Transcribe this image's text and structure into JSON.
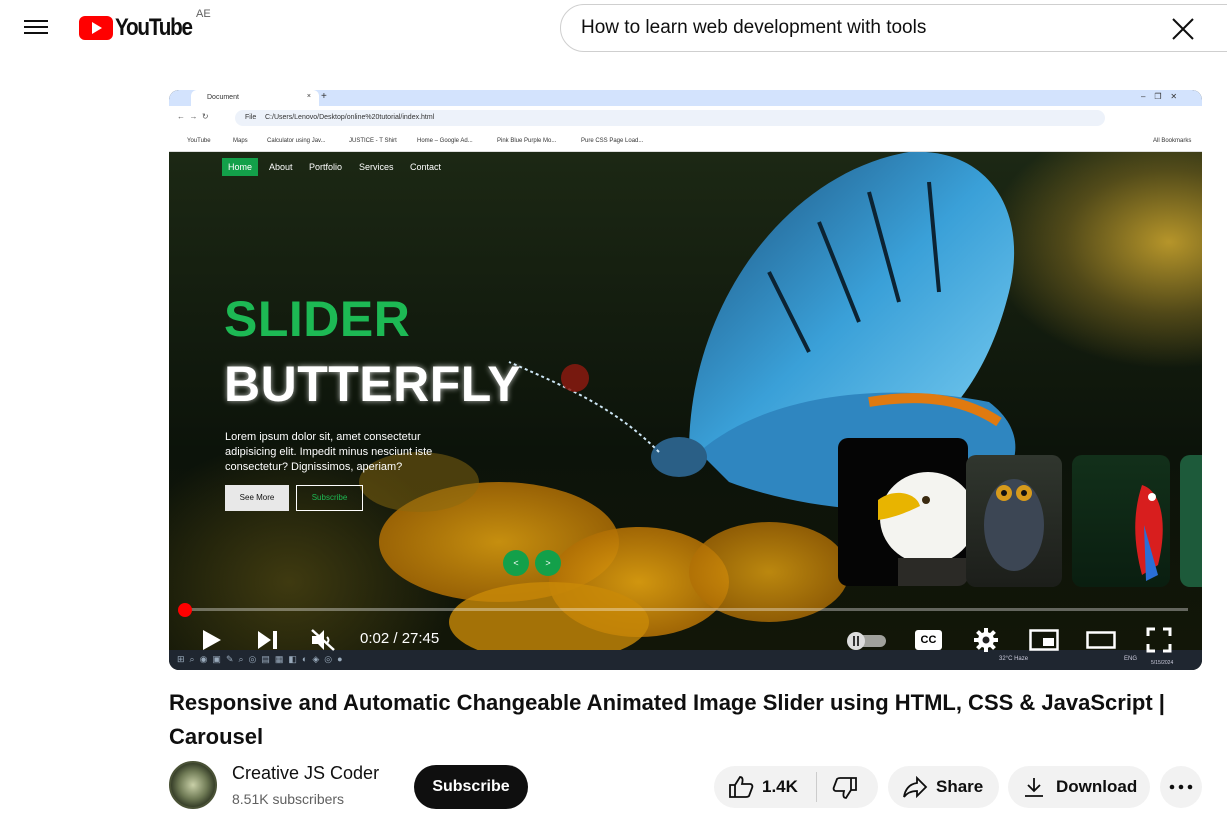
{
  "masthead": {
    "logo_text": "YouTube",
    "country": "AE",
    "search_value": "How to learn web development with tools"
  },
  "player": {
    "browser": {
      "tab_title": "Document",
      "url_scheme": "File",
      "url": "C:/Users/Lenovo/Desktop/online%20tutorial/index.html",
      "bookmarks": [
        "YouTube",
        "Maps",
        "Calculator using Jav...",
        "JUSTICE - T Shirt",
        "Home – Google Ad...",
        "Pink Blue Purple Mo...",
        "Pure CSS Page Load..."
      ],
      "all_bookmarks": "All Bookmarks"
    },
    "site": {
      "nav": [
        "Home",
        "About",
        "Portfolio",
        "Services",
        "Contact"
      ],
      "title1": "SLIDER",
      "title2": "BUTTERFLY",
      "description": "Lorem ipsum dolor sit, amet consectetur adipisicing elit. Impedit minus nesciunt iste consectetur? Dignissimos, aperiam?",
      "see_more": "See More",
      "subscribe": "Subscribe",
      "prev": "<",
      "next": ">"
    },
    "taskbar": {
      "temp": "32°C  Haze",
      "lang": "ENG",
      "date": "5/15/2024"
    },
    "current_time": "0:02",
    "duration": "27:45",
    "time_display": "0:02 / 27:45",
    "progress": 0.0012,
    "cc_label": "CC"
  },
  "video": {
    "title": "Responsive and Automatic Changeable Animated Image Slider using HTML, CSS & JavaScript | Carousel"
  },
  "channel": {
    "name": "Creative JS Coder",
    "subscribers": "8.51K subscribers",
    "subscribe_label": "Subscribe"
  },
  "actions": {
    "likes": "1.4K",
    "share": "Share",
    "download": "Download"
  },
  "colors": {
    "brand_red": "#ff0000",
    "slider_green": "#1db954",
    "nav_green": "#13a04a"
  }
}
